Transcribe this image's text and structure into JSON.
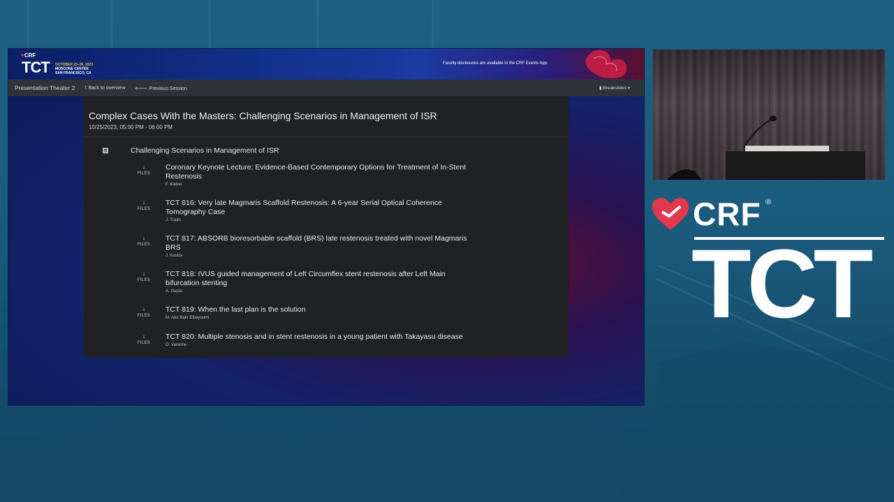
{
  "banner": {
    "brand_small": "CRF",
    "brand_large": "TCT",
    "event_dates": "OCTOBER 23–26, 2023",
    "venue_line1": "MOSCONE CENTER",
    "venue_line2": "SAN FRANCISCO, CA",
    "disclosure_text": "Faculty disclosures are available in the CRF Events App."
  },
  "navbar": {
    "title": "Presentation Theater 2",
    "back_label": "Back to overview",
    "prev_label": "Previous Session",
    "breakslides_label": "Breakslides"
  },
  "session": {
    "title": "Complex Cases With the Masters: Challenging Scenarios in Management of ISR",
    "time": "10/25/2023, 05:00 PM - 06:00 PM",
    "group_title": "Challenging Scenarios in Management of ISR",
    "files_label": "FILES",
    "talks": [
      {
        "title": "Coronary Keynote Lecture: Evidence-Based Contemporary Options for Treatment of In-Stent Restenosis",
        "author": "F. Kleber"
      },
      {
        "title": "TCT 816: Very late Magmaris Scaffold Restenosis: A 6-year Serial Optical Coherence Tomography Case",
        "author": "J. Traan"
      },
      {
        "title": "TCT 817: ABSORB bioresorbable scaffold (BRS) late restenosis treated with novel Magmaris BRS",
        "author": "J. Kostov"
      },
      {
        "title": "TCT 818: IVUS guided management of Left Circumflex stent restenosis after Left Main bifurcation stenting",
        "author": "A. Gupta"
      },
      {
        "title": "TCT 819: When the last plan is the solution",
        "author": "M. Abo Bakr Elbayoumi"
      },
      {
        "title": "TCT 820: Multiple stenosis and in stent restenosis in a young patient with Takayasu disease",
        "author": "O. Varenne"
      }
    ]
  },
  "brand_side": {
    "crf": "CRF",
    "registered": "®",
    "tct": "TCT"
  },
  "colors": {
    "crf_red": "#e2384d",
    "date_yellow": "#f6c343",
    "panel_bg": "#1f2125",
    "navbar_bg": "#2e3338"
  }
}
